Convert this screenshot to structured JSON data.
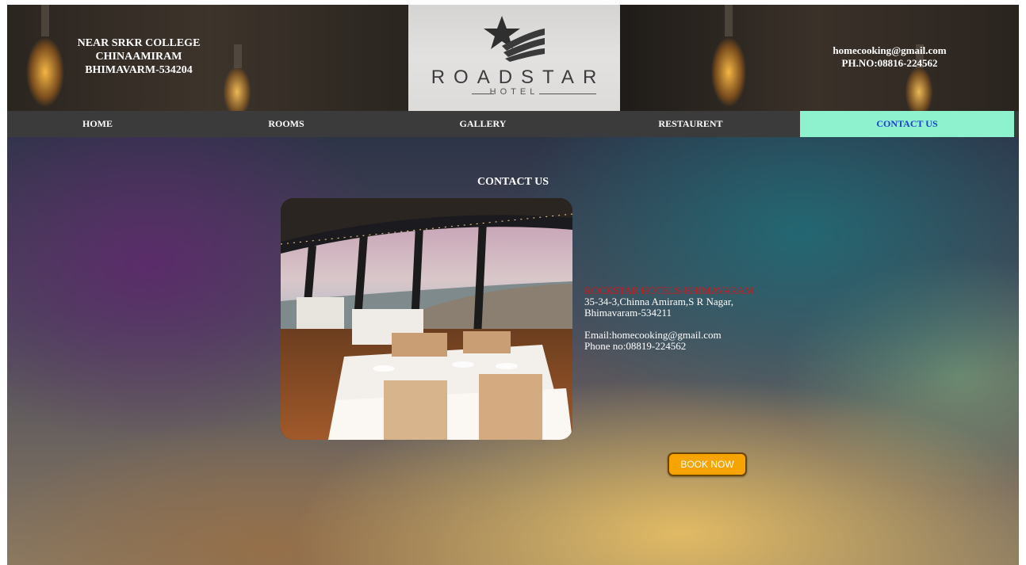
{
  "header": {
    "left_address_lines": [
      "NEAR SRKR COLLEGE",
      "CHINAAMIRAM",
      "BHIMAVARM-534204"
    ],
    "right_contact_lines": [
      "homecooking@gmail.com",
      "PH.NO:08816-224562"
    ],
    "logo": {
      "name": "ROADSTAR",
      "sub": "HOTEL"
    }
  },
  "nav": {
    "items": [
      {
        "label": "HOME"
      },
      {
        "label": "ROOMS"
      },
      {
        "label": "GALLERY"
      },
      {
        "label": "RESTAURENT"
      },
      {
        "label": "CONTACT US",
        "active": true
      }
    ]
  },
  "main": {
    "title": "CONTACT US",
    "address": {
      "hotel_name": "ROCKSTAR HOTELS-BHIMAVARAM",
      "line1": "35-34-3,Chinna Amiram,S R Nagar,",
      "line2": "Bhimavaram-534211",
      "email": "Email:homecooking@gmail.com",
      "phone": "Phone no:08819-224562"
    },
    "book_button": "BOOK NOW"
  },
  "colors": {
    "nav_bg": "#3b3b3b",
    "nav_active_bg": "#8ff2cf",
    "nav_active_text": "#1a3fd1",
    "hotel_name": "#d01818",
    "book_button": "#f7a400"
  }
}
